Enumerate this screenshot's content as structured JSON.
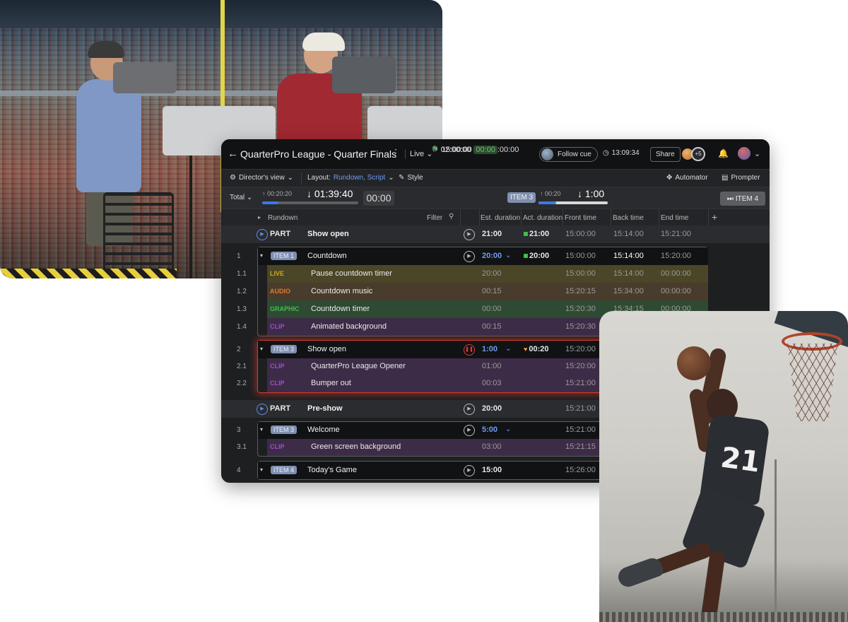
{
  "app": {
    "title": "QuarterPro League - Quarter Finals",
    "mode": "Live",
    "start_time": "15:00:00",
    "end_time": "17:00:00",
    "duration": "02:00:00",
    "duration_chip": "00:00",
    "follow_cue": "Follow cue",
    "clock": "13:09:34",
    "share": "Share",
    "extra_users": "+5"
  },
  "toolbar": {
    "view": "Director's view",
    "layout_label": "Layout:",
    "layout_value": "Rundown, Script",
    "style": "Style",
    "automator": "Automator",
    "prompter": "Prompter"
  },
  "timer": {
    "total": "Total",
    "elapsed": "00:20:20",
    "remaining": "01:39:40",
    "over_under": "00:00",
    "progress": 0.17,
    "current_item": "ITEM 3",
    "current_elapsed": "00:20",
    "current_remaining": "1:00",
    "current_progress": 0.25,
    "next_item": "ITEM 4"
  },
  "columns": {
    "rundown": "Rundown",
    "filter": "Filter",
    "est": "Est. duration",
    "act": "Act. duration",
    "front": "Front time",
    "back": "Back time",
    "end": "End time"
  },
  "rows": [
    {
      "kind": "part",
      "label": "PART",
      "title": "Show open",
      "est": "21:00",
      "act": "21:00",
      "front": "15:00:00",
      "back": "15:14:00",
      "end": "15:21:00"
    },
    {
      "kind": "item",
      "num": "1",
      "badge": "ITEM 1",
      "title": "Countdown",
      "est": "20:00",
      "act": "20:00",
      "front": "15:00:00",
      "back": "15:14:00",
      "end": "15:20:00"
    },
    {
      "kind": "sub",
      "num": "1.1",
      "type": "LIVE",
      "title": "Pause countdown timer",
      "est": "20:00",
      "front": "15:00:00",
      "back": "15:14:00",
      "end": "00:00:00"
    },
    {
      "kind": "sub",
      "num": "1.2",
      "type": "AUDIO",
      "title": "Countdown music",
      "est": "00:15",
      "front": "15:20:15",
      "back": "15:34:00",
      "end": "00:00:00"
    },
    {
      "kind": "sub",
      "num": "1.3",
      "type": "GRAPHIC",
      "title": "Countdown timer",
      "est": "00:00",
      "front": "15:20:30",
      "back": "15:34:15",
      "end": "00:00:00"
    },
    {
      "kind": "sub",
      "num": "1.4",
      "type": "CLIP",
      "title": "Animated background",
      "est": "00:15",
      "front": "15:20:30"
    },
    {
      "kind": "item",
      "num": "2",
      "badge": "ITEM 3",
      "title": "Show open",
      "est": "1:00",
      "act": "00:20",
      "front": "15:20:00"
    },
    {
      "kind": "sub",
      "num": "2.1",
      "type": "CLIP",
      "title": "QuarterPro League Opener",
      "est": "01:00",
      "front": "15:20:00"
    },
    {
      "kind": "sub",
      "num": "2.2",
      "type": "CLIP",
      "title": "Bumper out",
      "est": "00:03",
      "front": "15:21:00"
    },
    {
      "kind": "part",
      "label": "PART",
      "title": "Pre-show",
      "est": "20:00",
      "front": "15:21:00"
    },
    {
      "kind": "item",
      "num": "3",
      "badge": "ITEM 3",
      "title": "Welcome",
      "est": "5:00",
      "front": "15:21:00"
    },
    {
      "kind": "sub",
      "num": "3.1",
      "type": "CLIP",
      "title": "Green screen background",
      "est": "03:00",
      "front": "15:21:15"
    },
    {
      "kind": "item",
      "num": "4",
      "badge": "ITEM 4",
      "title": "Today's Game",
      "est": "15:00",
      "front": "15:26:00"
    }
  ],
  "photos": {
    "jersey_number": "21"
  },
  "colors": {
    "live": "#c9a928",
    "audio": "#e07a2e",
    "graphic": "#3fbf4d",
    "clip": "#a24bd6",
    "accent": "#3e77e6",
    "active_border": "#d63a2c"
  }
}
